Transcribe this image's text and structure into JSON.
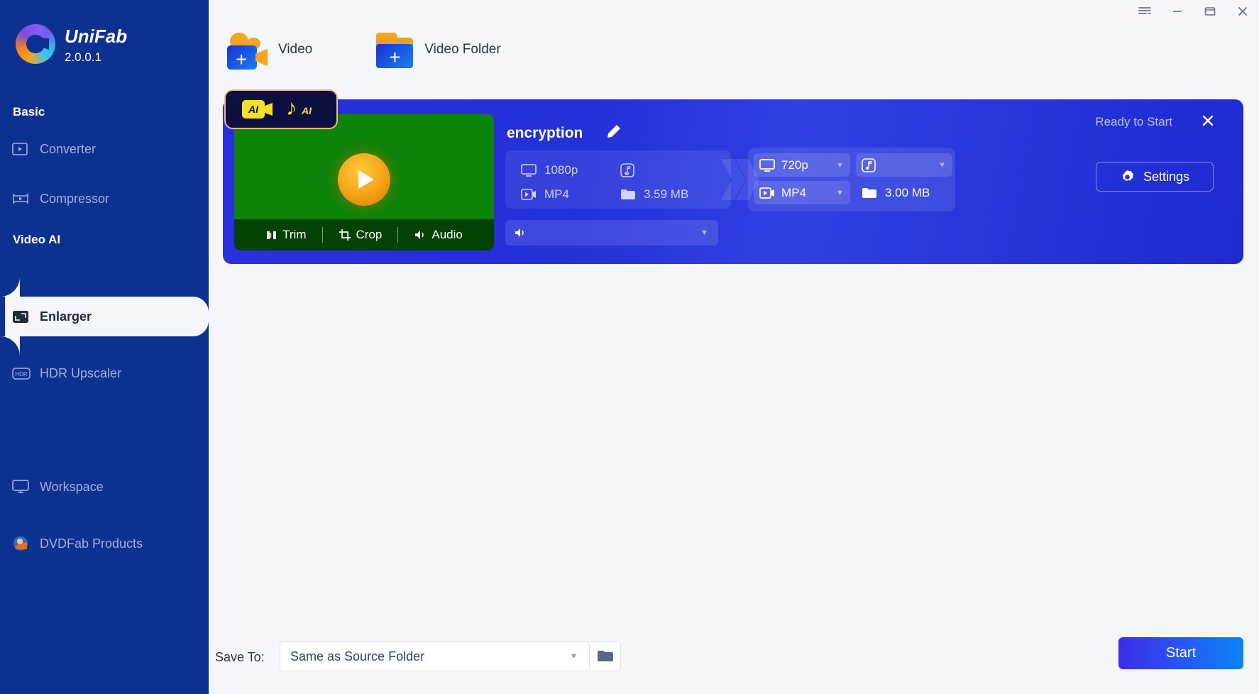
{
  "app": {
    "name": "UniFab",
    "version": "2.0.0.1"
  },
  "titlebar": {
    "menu_icon": "hamburger-icon",
    "minimize_icon": "minimize-icon",
    "maximize_icon": "maximize-icon",
    "close_icon": "close-icon"
  },
  "sidebar": {
    "groups": [
      {
        "label": "Basic"
      },
      {
        "label": "Video AI"
      }
    ],
    "items": [
      {
        "label": "Converter",
        "icon": "converter-icon",
        "active": false
      },
      {
        "label": "Compressor",
        "icon": "compressor-icon",
        "active": false
      },
      {
        "label": "Enlarger",
        "icon": "enlarger-icon",
        "active": true
      },
      {
        "label": "HDR Upscaler",
        "icon": "hdr-icon",
        "active": false
      },
      {
        "label": "Workspace",
        "icon": "monitor-icon",
        "active": false
      },
      {
        "label": "DVDFab Products",
        "icon": "dvdfab-icon",
        "active": false
      }
    ]
  },
  "toolbar": {
    "add_video_label": "Video",
    "add_video_folder_label": "Video Folder"
  },
  "task": {
    "title": "encryption",
    "edit_icon": "pencil-icon",
    "status": "Ready to Start",
    "close_icon": "close-icon",
    "settings_label": "Settings",
    "settings_icon": "gear-icon",
    "ai_badge": {
      "video_ai_label": "AI",
      "audio_ai_label": "AI"
    },
    "thumbnail_tools": [
      {
        "label": "Trim",
        "icon": "trim-icon"
      },
      {
        "label": "Crop",
        "icon": "crop-icon"
      },
      {
        "label": "Audio",
        "icon": "audio-icon"
      }
    ],
    "source": {
      "resolution": "1080p",
      "format": "MP4",
      "size": "3.59 MB",
      "audio_icon": "music-note-icon"
    },
    "target": {
      "resolution": "720p",
      "format": "MP4",
      "size": "3.00 MB",
      "audio_icon": "music-note-icon"
    },
    "audio_track": {
      "value": "",
      "icon": "speaker-icon"
    }
  },
  "bottom": {
    "save_to_label": "Save To:",
    "save_to_value": "Same as Source Folder",
    "browse_icon": "folder-icon",
    "start_label": "Start"
  },
  "colors": {
    "sidebar_bg": "#0d3190",
    "page_bg": "#f4f6fa",
    "card_bg": "#2a30e0",
    "accent": "#1a7ef0",
    "ai_yellow": "#f5e023",
    "thumb_green": "#0c8409",
    "play_orange": "#f7a81b"
  }
}
